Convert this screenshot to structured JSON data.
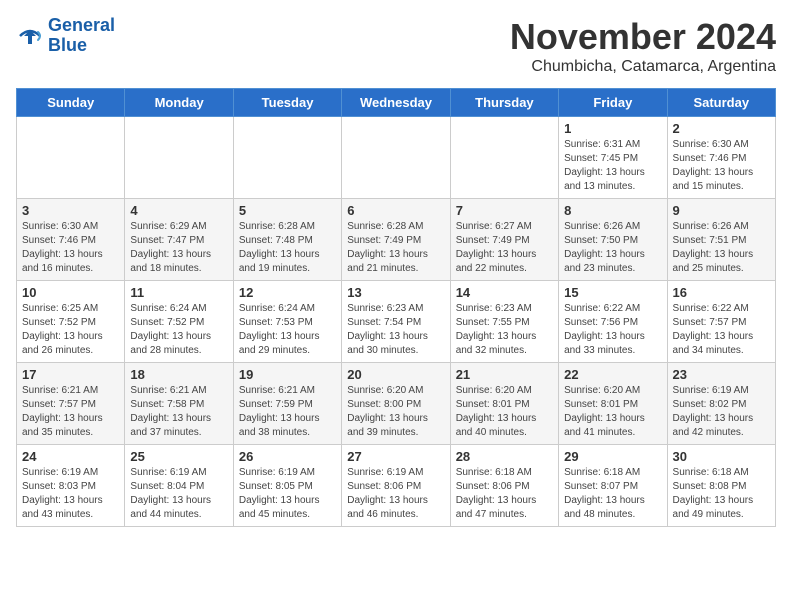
{
  "logo": {
    "line1": "General",
    "line2": "Blue"
  },
  "title": "November 2024",
  "location": "Chumbicha, Catamarca, Argentina",
  "weekdays": [
    "Sunday",
    "Monday",
    "Tuesday",
    "Wednesday",
    "Thursday",
    "Friday",
    "Saturday"
  ],
  "weeks": [
    [
      {
        "day": "",
        "info": ""
      },
      {
        "day": "",
        "info": ""
      },
      {
        "day": "",
        "info": ""
      },
      {
        "day": "",
        "info": ""
      },
      {
        "day": "",
        "info": ""
      },
      {
        "day": "1",
        "info": "Sunrise: 6:31 AM\nSunset: 7:45 PM\nDaylight: 13 hours\nand 13 minutes."
      },
      {
        "day": "2",
        "info": "Sunrise: 6:30 AM\nSunset: 7:46 PM\nDaylight: 13 hours\nand 15 minutes."
      }
    ],
    [
      {
        "day": "3",
        "info": "Sunrise: 6:30 AM\nSunset: 7:46 PM\nDaylight: 13 hours\nand 16 minutes."
      },
      {
        "day": "4",
        "info": "Sunrise: 6:29 AM\nSunset: 7:47 PM\nDaylight: 13 hours\nand 18 minutes."
      },
      {
        "day": "5",
        "info": "Sunrise: 6:28 AM\nSunset: 7:48 PM\nDaylight: 13 hours\nand 19 minutes."
      },
      {
        "day": "6",
        "info": "Sunrise: 6:28 AM\nSunset: 7:49 PM\nDaylight: 13 hours\nand 21 minutes."
      },
      {
        "day": "7",
        "info": "Sunrise: 6:27 AM\nSunset: 7:49 PM\nDaylight: 13 hours\nand 22 minutes."
      },
      {
        "day": "8",
        "info": "Sunrise: 6:26 AM\nSunset: 7:50 PM\nDaylight: 13 hours\nand 23 minutes."
      },
      {
        "day": "9",
        "info": "Sunrise: 6:26 AM\nSunset: 7:51 PM\nDaylight: 13 hours\nand 25 minutes."
      }
    ],
    [
      {
        "day": "10",
        "info": "Sunrise: 6:25 AM\nSunset: 7:52 PM\nDaylight: 13 hours\nand 26 minutes."
      },
      {
        "day": "11",
        "info": "Sunrise: 6:24 AM\nSunset: 7:52 PM\nDaylight: 13 hours\nand 28 minutes."
      },
      {
        "day": "12",
        "info": "Sunrise: 6:24 AM\nSunset: 7:53 PM\nDaylight: 13 hours\nand 29 minutes."
      },
      {
        "day": "13",
        "info": "Sunrise: 6:23 AM\nSunset: 7:54 PM\nDaylight: 13 hours\nand 30 minutes."
      },
      {
        "day": "14",
        "info": "Sunrise: 6:23 AM\nSunset: 7:55 PM\nDaylight: 13 hours\nand 32 minutes."
      },
      {
        "day": "15",
        "info": "Sunrise: 6:22 AM\nSunset: 7:56 PM\nDaylight: 13 hours\nand 33 minutes."
      },
      {
        "day": "16",
        "info": "Sunrise: 6:22 AM\nSunset: 7:57 PM\nDaylight: 13 hours\nand 34 minutes."
      }
    ],
    [
      {
        "day": "17",
        "info": "Sunrise: 6:21 AM\nSunset: 7:57 PM\nDaylight: 13 hours\nand 35 minutes."
      },
      {
        "day": "18",
        "info": "Sunrise: 6:21 AM\nSunset: 7:58 PM\nDaylight: 13 hours\nand 37 minutes."
      },
      {
        "day": "19",
        "info": "Sunrise: 6:21 AM\nSunset: 7:59 PM\nDaylight: 13 hours\nand 38 minutes."
      },
      {
        "day": "20",
        "info": "Sunrise: 6:20 AM\nSunset: 8:00 PM\nDaylight: 13 hours\nand 39 minutes."
      },
      {
        "day": "21",
        "info": "Sunrise: 6:20 AM\nSunset: 8:01 PM\nDaylight: 13 hours\nand 40 minutes."
      },
      {
        "day": "22",
        "info": "Sunrise: 6:20 AM\nSunset: 8:01 PM\nDaylight: 13 hours\nand 41 minutes."
      },
      {
        "day": "23",
        "info": "Sunrise: 6:19 AM\nSunset: 8:02 PM\nDaylight: 13 hours\nand 42 minutes."
      }
    ],
    [
      {
        "day": "24",
        "info": "Sunrise: 6:19 AM\nSunset: 8:03 PM\nDaylight: 13 hours\nand 43 minutes."
      },
      {
        "day": "25",
        "info": "Sunrise: 6:19 AM\nSunset: 8:04 PM\nDaylight: 13 hours\nand 44 minutes."
      },
      {
        "day": "26",
        "info": "Sunrise: 6:19 AM\nSunset: 8:05 PM\nDaylight: 13 hours\nand 45 minutes."
      },
      {
        "day": "27",
        "info": "Sunrise: 6:19 AM\nSunset: 8:06 PM\nDaylight: 13 hours\nand 46 minutes."
      },
      {
        "day": "28",
        "info": "Sunrise: 6:18 AM\nSunset: 8:06 PM\nDaylight: 13 hours\nand 47 minutes."
      },
      {
        "day": "29",
        "info": "Sunrise: 6:18 AM\nSunset: 8:07 PM\nDaylight: 13 hours\nand 48 minutes."
      },
      {
        "day": "30",
        "info": "Sunrise: 6:18 AM\nSunset: 8:08 PM\nDaylight: 13 hours\nand 49 minutes."
      }
    ]
  ]
}
